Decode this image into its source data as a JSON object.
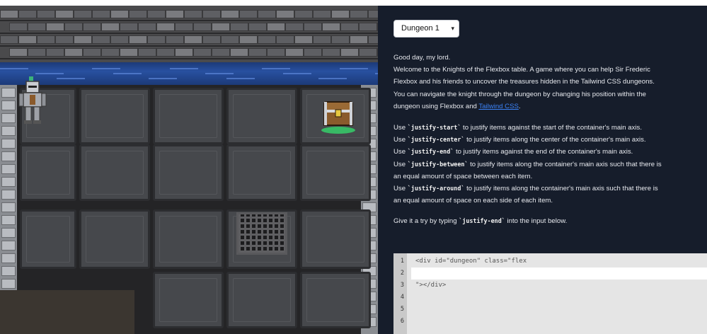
{
  "level_select": {
    "value": "Dungeon 1",
    "chevron": "▾"
  },
  "intro": {
    "greeting": "Good day, my lord.",
    "p1_l1": "Welcome to the Knights of the Flexbox table. A game where you can help Sir Frederic",
    "p1_l2": "Flexbox and his friends to uncover the treasures hidden in the Tailwind CSS dungeons.",
    "p1_l3": "You can navigate the knight through the dungeon by changing his position within the",
    "p1_l4_prefix": "dungeon using Flexbox and ",
    "p1_l4_link": "Tailwind CSS",
    "p1_l4_suffix": "."
  },
  "instructions": [
    {
      "pre": "Use ",
      "code": "`justify-start`",
      "post": " to justify items against the start of the container's main axis."
    },
    {
      "pre": "Use ",
      "code": "`justify-center`",
      "post": " to justify items along the center of the container's main axis."
    },
    {
      "pre": "Use ",
      "code": "`justify-end`",
      "post": " to justify items against the end of the container's main axis."
    },
    {
      "pre": "Use ",
      "code": "`justify-between`",
      "post": " to justify items along the container's main axis such that there is"
    },
    {
      "pre": "an equal amount of space between each item.",
      "code": "",
      "post": ""
    },
    {
      "pre": "Use ",
      "code": "`justify-around`",
      "post": " to justify items along the container's main axis such that there is"
    },
    {
      "pre": "an equal amount of space on each side of each item.",
      "code": "",
      "post": ""
    }
  ],
  "prompt": {
    "pre": "Give it a try by typing ",
    "code": "`justify-end`",
    "post": " into the input below."
  },
  "editor": {
    "line_numbers": [
      "1",
      "2",
      "3",
      "4",
      "5",
      "6"
    ],
    "line1": "<div id=\"dungeon\" class=\"flex",
    "line2_value": "",
    "line3": "\"></div>"
  },
  "icons": {
    "level_chevron": "chevron-down-icon",
    "knight": "knight-sprite-icon",
    "chest": "treasure-chest-icon"
  },
  "colors": {
    "panel_bg": "#161d2b",
    "link": "#3b82f6",
    "water": "#2850a0"
  }
}
